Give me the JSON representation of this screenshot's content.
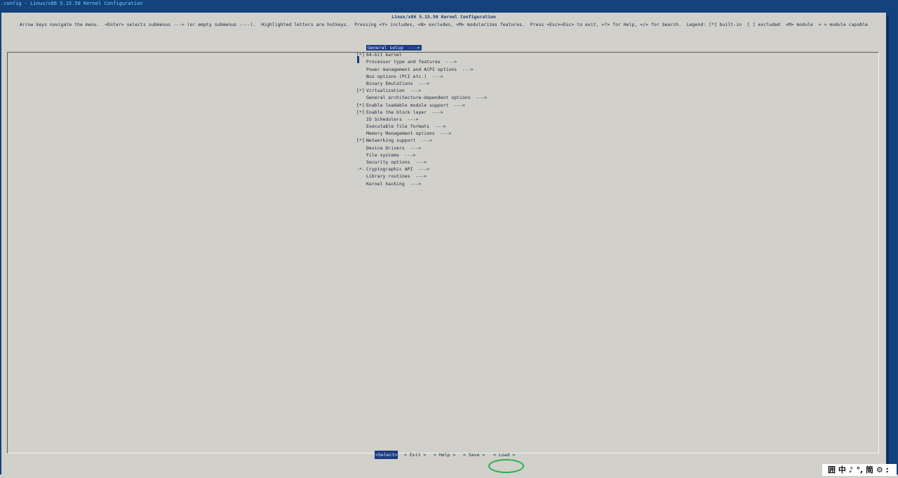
{
  "window": {
    "title": ".config - Linux/x86 5.15.50 Kernel Configuration"
  },
  "dialog": {
    "title": "Linux/x86 5.15.50 Kernel Configuration",
    "help": "Arrow keys navigate the menu.  <Enter> selects submenus ---> (or empty submenus ----).  Highlighted letters are hotkeys.  Pressing <Y> includes, <N> excludes, <M> modularizes features.  Press <Esc><Esc> to exit, <?> for Help, </> for Search.  Legend: [*] built-in  [ ] excluded  <M> module  < > module capable"
  },
  "menu": {
    "items": [
      {
        "mark": "",
        "label": "General setup  --->",
        "selected": true
      },
      {
        "mark": "[*]",
        "label": "64-bit kernel"
      },
      {
        "mark": "",
        "label": "Processor type and features  --->"
      },
      {
        "mark": "",
        "label": "Power management and ACPI options  --->"
      },
      {
        "mark": "",
        "label": "Bus options (PCI etc.)  --->"
      },
      {
        "mark": "",
        "label": "Binary Emulations  --->"
      },
      {
        "mark": "[*]",
        "label": "Virtualization  --->"
      },
      {
        "mark": "",
        "label": "General architecture-dependent options  --->"
      },
      {
        "mark": "[*]",
        "label": "Enable loadable module support  --->"
      },
      {
        "mark": "[*]",
        "label": "Enable the block layer  --->"
      },
      {
        "mark": "",
        "label": "IO Schedulers  --->"
      },
      {
        "mark": "",
        "label": "Executable file formats  --->"
      },
      {
        "mark": "",
        "label": "Memory Management options  --->"
      },
      {
        "mark": "[*]",
        "label": "Networking support  --->"
      },
      {
        "mark": "",
        "label": "Device Drivers  --->"
      },
      {
        "mark": "",
        "label": "File systems  --->"
      },
      {
        "mark": "",
        "label": "Security options  --->"
      },
      {
        "mark": "-*-",
        "label": "Cryptographic API  --->"
      },
      {
        "mark": "",
        "label": "Library routines  --->"
      },
      {
        "mark": "",
        "label": "Kernel hacking  --->"
      }
    ]
  },
  "buttons": {
    "select": "<Select>",
    "exit": "< Exit >",
    "help": "< Help >",
    "save": "< Save >",
    "load": "< Load >"
  },
  "taskbar": {
    "ime_text": "囲 中 ♪ °, 简 ⚙ :"
  },
  "colors": {
    "background": "#13427d",
    "dialog": "#d1d0cb",
    "selection": "#1b3d82",
    "annotation_ring": "#29b14a"
  }
}
